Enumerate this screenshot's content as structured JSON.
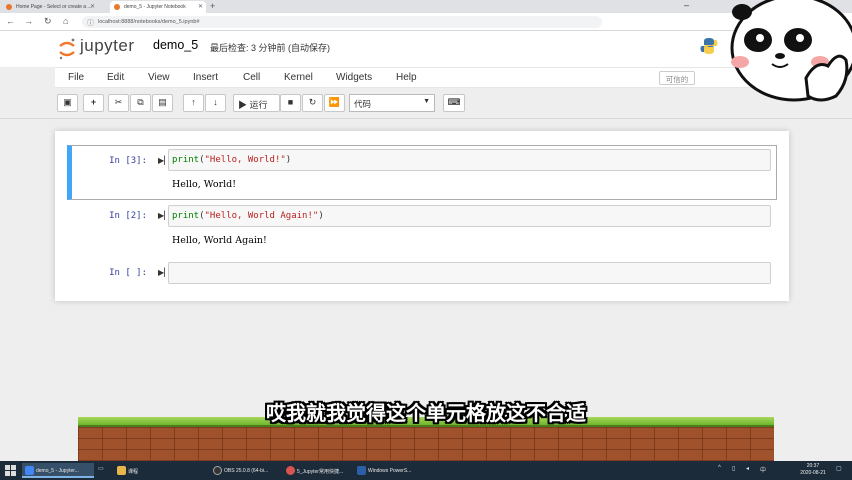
{
  "browser": {
    "tabs": [
      {
        "title": "Home Page - Select or create a ...",
        "active": false
      },
      {
        "title": "demo_5 - Jupyter Notebook",
        "active": true
      }
    ],
    "url": "localhost:8888/notebooks/demo_5.ipynb#"
  },
  "jupyter": {
    "logo_text": "jupyter",
    "notebook_name": "demo_5",
    "checkpoint_status": "最后检查: 3 分钟前 (自动保存)",
    "trusted_label": "可信的"
  },
  "menu": [
    "File",
    "Edit",
    "View",
    "Insert",
    "Cell",
    "Kernel",
    "Widgets",
    "Help"
  ],
  "toolbar": {
    "run_label": "运行",
    "cell_type": "代码"
  },
  "cells": [
    {
      "prompt": "In [3]:",
      "code_func": "print",
      "code_open": "(",
      "code_string": "\"Hello, World!\"",
      "code_close": ")",
      "output": "Hello, World!",
      "selected": true
    },
    {
      "prompt": "In [2]:",
      "code_func": "print",
      "code_open": "(",
      "code_string": "\"Hello, World Again!\"",
      "code_close": ")",
      "output": "Hello, World Again!",
      "selected": false
    },
    {
      "prompt": "In [ ]:",
      "code_func": "",
      "code_open": "",
      "code_string": "",
      "code_close": "",
      "output": "",
      "selected": false
    }
  ],
  "subtitle": "哎我就我觉得这个单元格放这不合适",
  "taskbar": {
    "items": [
      {
        "label": "demo_5 - Jupyter..."
      },
      {
        "label": "课程"
      },
      {
        "label": "OBS 25.0.8 (64-bi..."
      },
      {
        "label": "5_Jupyter常用快捷..."
      },
      {
        "label": "Windows PowerS..."
      }
    ],
    "time": "20:37",
    "date": "2020-08-21"
  },
  "colors": {
    "selected_cell_border": "#42a5f5",
    "prompt_color": "#303f9f",
    "string_color": "#ba2121",
    "keyword_color": "#008000"
  }
}
